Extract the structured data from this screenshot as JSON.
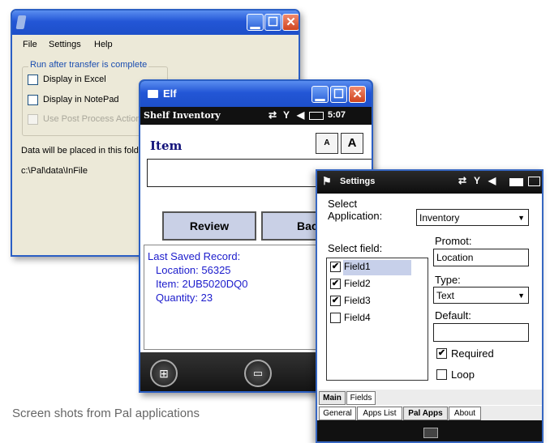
{
  "window1": {
    "menu": [
      "File",
      "Settings",
      "Help"
    ],
    "group_title": "Run after transfer is complete",
    "options": [
      {
        "label": "Display in Excel",
        "checked": false,
        "disabled": false
      },
      {
        "label": "Display in NotePad",
        "checked": false,
        "disabled": false
      },
      {
        "label": "Use Post Process Action",
        "checked": false,
        "disabled": true
      }
    ],
    "folder_label": "Data will be placed in this folder",
    "folder_path": "c:\\Pal\\data\\InFile"
  },
  "window2": {
    "title": "Elf",
    "status_title": "Shelf Inventory",
    "status_time": "5:07",
    "heading": "Item",
    "font_small": "A",
    "font_large": "A",
    "item_input_value": "",
    "review_label": "Review",
    "back_label": "Bac",
    "record": {
      "title": "Last Saved Record:",
      "location": "Location: 56325",
      "item": "Item: 2UB5020DQ0",
      "quantity": "Quantity: 23"
    }
  },
  "window3": {
    "status_title": "Settings",
    "select_application_label": [
      "Select",
      "Application:"
    ],
    "application_value": "Inventory",
    "select_field_label": "Select field:",
    "fields": [
      {
        "label": "Field1",
        "checked": true,
        "selected": true
      },
      {
        "label": "Field2",
        "checked": true,
        "selected": false
      },
      {
        "label": "Field3",
        "checked": true,
        "selected": false
      },
      {
        "label": "Field4",
        "checked": false,
        "selected": false
      }
    ],
    "prompt_label": "Promot:",
    "prompt_value": "Location",
    "type_label": "Type:",
    "type_value": "Text",
    "default_label": "Default:",
    "default_value": "",
    "required_label": "Required",
    "required_checked": true,
    "loop_label": "Loop",
    "loop_checked": false,
    "inner_tabs": [
      "Main",
      "Fields"
    ],
    "outer_tabs": [
      "General",
      "Apps List",
      "Pal Apps",
      "About"
    ],
    "selected_outer_tab": "Pal Apps"
  },
  "caption": "Screen shots from Pal applications",
  "colors": {
    "xp_title_blue": "#2356d6",
    "record_text_blue": "#1b1bcc",
    "close_red": "#d0441f"
  }
}
